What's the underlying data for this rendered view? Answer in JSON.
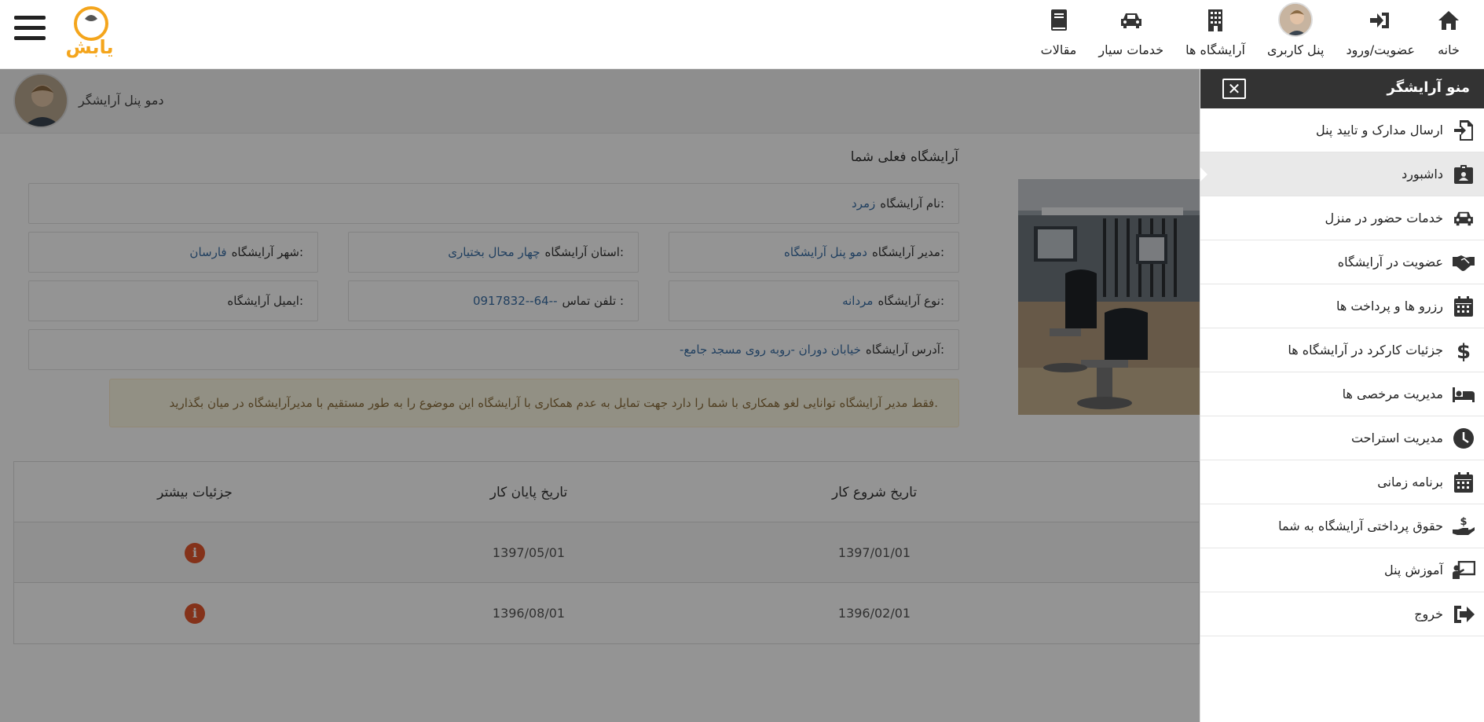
{
  "navbar": {
    "items": [
      {
        "label": "خانه",
        "icon": "home-icon"
      },
      {
        "label": "عضویت/ورود",
        "icon": "sign-in-icon"
      },
      {
        "label": "پنل کاربری",
        "icon": "user-avatar"
      },
      {
        "label": "آرایشگاه ها",
        "icon": "building-icon"
      },
      {
        "label": "خدمات سیار",
        "icon": "car-icon"
      },
      {
        "label": "مقالات",
        "icon": "book-icon"
      }
    ],
    "logo_text": "یابش"
  },
  "user": {
    "name": "دمو پنل آرایشگر"
  },
  "current_salon": {
    "title": "آرایشگاه فعلی شما",
    "name_label": "نام آرایشگاه:",
    "name": "زمرد",
    "manager_label": "مدیر آرایشگاه:",
    "manager": "دمو پنل آرایشگاه",
    "province_label": "استان آرایشگاه:",
    "province": "چهار محال بختیاری",
    "city_label": "شهر آرایشگاه:",
    "city": "فارسان",
    "type_label": "نوع آرایشگاه:",
    "type": "مردانه",
    "phone_label": "تلفن تماس :",
    "phone": "0917832--64--",
    "email_label": "ایمیل آرایشگاه:",
    "email": "",
    "address_label": "آدرس آرایشگاه:",
    "address": "-خیابان دوران -روبه روی مسجد جامع",
    "warning": "فقط مدیر آرایشگاه توانایی لغو همکاری با شما را دارد جهت تمایل به عدم همکاری با آرایشگاه این موضوع را به طور مستقیم با مدیرآرایشگاه در میان بگذارید."
  },
  "history": {
    "headers": {
      "start": "تاریخ شروع کار",
      "end": "تاریخ پایان کار",
      "details": "جزئیات بیشتر"
    },
    "rows": [
      {
        "start": "1397/01/01",
        "end": "1397/05/01"
      },
      {
        "start": "1396/02/01",
        "end": "1396/08/01"
      }
    ]
  },
  "sidebar": {
    "title": "منو آرایشگر",
    "items": [
      {
        "label": "ارسال مدارک و تایید پنل",
        "icon": "file-import-icon"
      },
      {
        "label": "داشبورد",
        "icon": "id-badge-icon",
        "active": true
      },
      {
        "label": "خدمات حضور در منزل",
        "icon": "car-icon"
      },
      {
        "label": "عضویت در آرایشگاه",
        "icon": "handshake-icon"
      },
      {
        "label": "رزرو ها و پرداخت ها",
        "icon": "calendar-icon"
      },
      {
        "label": "جزئیات کارکرد در آرایشگاه ها",
        "icon": "dollar-icon"
      },
      {
        "label": "مدیریت مرخصی ها",
        "icon": "bed-icon"
      },
      {
        "label": "مدیریت استراحت",
        "icon": "clock-icon"
      },
      {
        "label": "برنامه زمانی",
        "icon": "calendar-icon"
      },
      {
        "label": "حقوق پرداختی آرایشگاه به شما",
        "icon": "hand-coin-icon"
      },
      {
        "label": "آموزش پنل",
        "icon": "chalkboard-teacher-icon"
      },
      {
        "label": "خروج",
        "icon": "sign-out-icon"
      }
    ]
  }
}
